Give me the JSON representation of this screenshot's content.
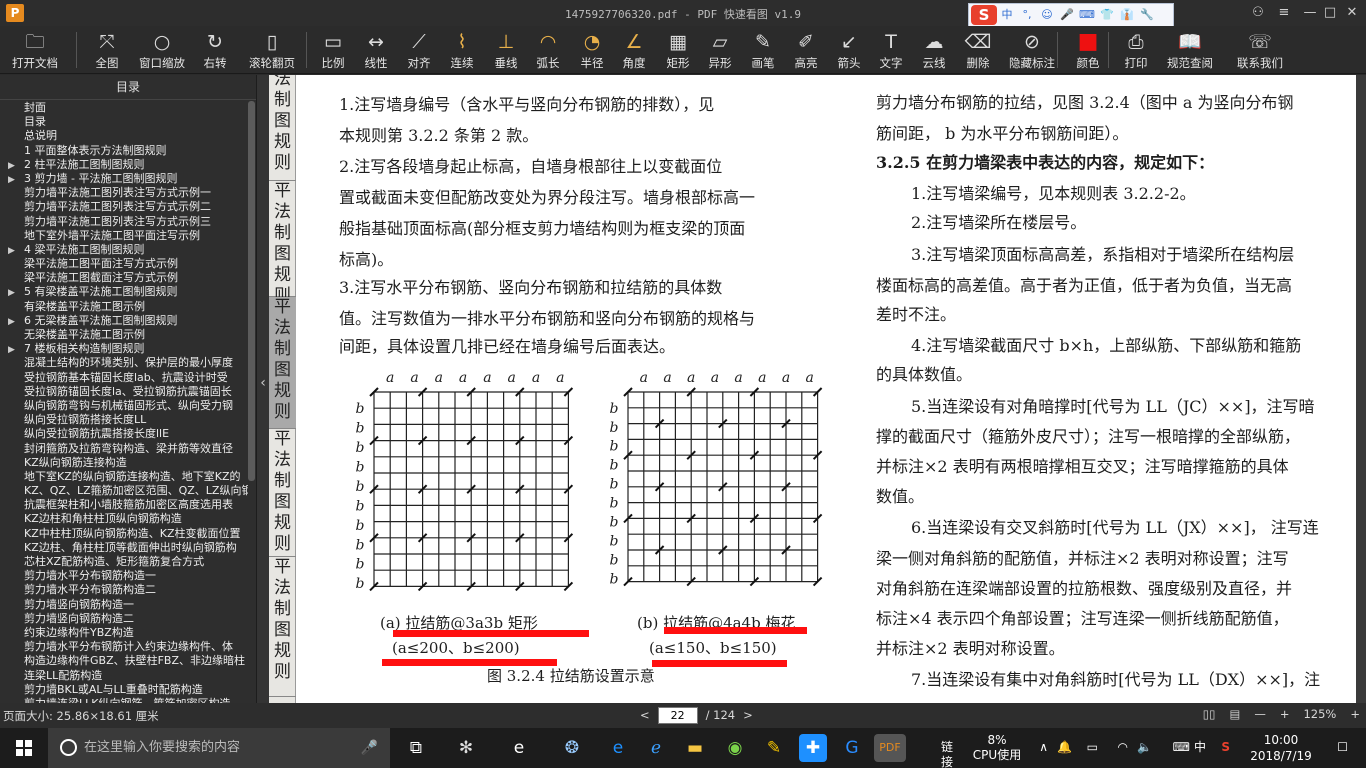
{
  "window": {
    "title": "1475927706320.pdf - PDF 快速看图 v1.9",
    "logo_letter": "P",
    "controls": [
      "≡",
      "—",
      "□",
      "✕"
    ],
    "user_icon": "person-icon"
  },
  "ime": {
    "logo": "S",
    "items": [
      "中",
      "°,",
      "☺",
      "🎤",
      "⌨",
      "👕",
      "👔",
      "🔧"
    ]
  },
  "toolbar": {
    "tools": [
      {
        "label": "打开文档",
        "icon": "folder-icon",
        "glyph": "🗀"
      },
      {
        "label": "全图",
        "icon": "fullview-icon",
        "glyph": "⤧"
      },
      {
        "label": "窗口缩放",
        "icon": "magnifier-icon",
        "glyph": "○"
      },
      {
        "label": "右转",
        "icon": "rotate-right-icon",
        "glyph": "↻"
      },
      {
        "label": "滚轮翻页",
        "icon": "mouse-icon",
        "glyph": "▯"
      },
      {
        "label": "比例",
        "icon": "ruler-icon",
        "glyph": "▭"
      },
      {
        "label": "线性",
        "icon": "linear-measure-icon",
        "glyph": "↔"
      },
      {
        "label": "对齐",
        "icon": "aligned-measure-icon",
        "glyph": "⟋"
      },
      {
        "label": "连续",
        "icon": "continuous-measure-icon",
        "glyph": "⌇"
      },
      {
        "label": "垂线",
        "icon": "perpendicular-icon",
        "glyph": "⊥"
      },
      {
        "label": "弧长",
        "icon": "arc-length-icon",
        "glyph": "◠"
      },
      {
        "label": "半径",
        "icon": "radius-icon",
        "glyph": "◔"
      },
      {
        "label": "角度",
        "icon": "angle-icon",
        "glyph": "∠"
      },
      {
        "label": "矩形",
        "icon": "rectangle-icon",
        "glyph": "▦"
      },
      {
        "label": "异形",
        "icon": "polygon-icon",
        "glyph": "▱"
      },
      {
        "label": "画笔",
        "icon": "pen-icon",
        "glyph": "✎"
      },
      {
        "label": "高亮",
        "icon": "highlighter-icon",
        "glyph": "✐"
      },
      {
        "label": "箭头",
        "icon": "arrow-icon",
        "glyph": "↙"
      },
      {
        "label": "文字",
        "icon": "text-icon",
        "glyph": "T"
      },
      {
        "label": "云线",
        "icon": "cloud-line-icon",
        "glyph": "☁"
      },
      {
        "label": "删除",
        "icon": "eraser-icon",
        "glyph": "⌫"
      },
      {
        "label": "隐藏标注",
        "icon": "hide-annotations-icon",
        "glyph": "⊘"
      },
      {
        "label": "颜色",
        "icon": "color-swatch-icon",
        "glyph": "■"
      },
      {
        "label": "打印",
        "icon": "printer-icon",
        "glyph": "⎙"
      },
      {
        "label": "规范查阅",
        "icon": "book-icon",
        "glyph": "📖"
      },
      {
        "label": "联系我们",
        "icon": "contact-icon",
        "glyph": "☏"
      }
    ]
  },
  "sidebar": {
    "header": "目录",
    "items": [
      {
        "label": "封面",
        "arrow": ""
      },
      {
        "label": "目录",
        "arrow": ""
      },
      {
        "label": "总说明",
        "arrow": ""
      },
      {
        "label": "1 平面整体表示方法制图规则",
        "arrow": ""
      },
      {
        "label": "2 柱平法施工图制图规则",
        "arrow": "▶"
      },
      {
        "label": "3 剪力墙 - 平法施工图制图规则",
        "arrow": "▶"
      },
      {
        "label": "剪力墙平法施工图列表注写方式示例一",
        "arrow": ""
      },
      {
        "label": "剪力墙平法施工图列表注写方式示例二",
        "arrow": ""
      },
      {
        "label": "剪力墙平法施工图列表注写方式示例三",
        "arrow": ""
      },
      {
        "label": "地下室外墙平法施工图平面注写示例",
        "arrow": ""
      },
      {
        "label": "4 梁平法施工图制图规则",
        "arrow": "▶"
      },
      {
        "label": "梁平法施工图平面注写方式示例",
        "arrow": ""
      },
      {
        "label": "梁平法施工图截面注写方式示例",
        "arrow": ""
      },
      {
        "label": "5 有梁楼盖平法施工图制图规则",
        "arrow": "▶"
      },
      {
        "label": "有梁楼盖平法施工图示例",
        "arrow": ""
      },
      {
        "label": "6 无梁楼盖平法施工图制图规则",
        "arrow": "▶"
      },
      {
        "label": "无梁楼盖平法施工图示例",
        "arrow": ""
      },
      {
        "label": "7 楼板相关构造制图规则",
        "arrow": "▶"
      },
      {
        "label": "混凝土结构的环境类别、保护层的最小厚度",
        "arrow": ""
      },
      {
        "label": "受拉钢筋基本锚固长度lab、抗震设计时受",
        "arrow": ""
      },
      {
        "label": "受拉钢筋锚固长度la、受拉钢筋抗震锚固长",
        "arrow": ""
      },
      {
        "label": "纵向钢筋弯钩与机械锚固形式、纵向受力钢",
        "arrow": ""
      },
      {
        "label": "纵向受拉钢筋搭接长度LL",
        "arrow": ""
      },
      {
        "label": "纵向受拉钢筋抗震搭接长度llE",
        "arrow": ""
      },
      {
        "label": "封闭箍筋及拉筋弯钩构造、梁并筋等效直径",
        "arrow": ""
      },
      {
        "label": "KZ纵向钢筋连接构造",
        "arrow": ""
      },
      {
        "label": "地下室KZ的纵向钢筋连接构造、地下室KZ的",
        "arrow": ""
      },
      {
        "label": "KZ、QZ、LZ箍筋加密区范围、QZ、LZ纵向钢",
        "arrow": ""
      },
      {
        "label": "抗震框架柱和小墙肢箍筋加密区高度选用表",
        "arrow": ""
      },
      {
        "label": "KZ边柱和角柱柱顶纵向钢筋构造",
        "arrow": ""
      },
      {
        "label": "KZ中柱柱顶纵向钢筋构造、KZ柱变截面位置",
        "arrow": ""
      },
      {
        "label": "KZ边柱、角柱柱顶等截面伸出时纵向钢筋构",
        "arrow": ""
      },
      {
        "label": "芯柱XZ配筋构造、矩形箍筋复合方式",
        "arrow": ""
      },
      {
        "label": "剪力墙水平分布钢筋构造一",
        "arrow": ""
      },
      {
        "label": "剪力墙水平分布钢筋构造二",
        "arrow": ""
      },
      {
        "label": "剪力墙竖向钢筋构造一",
        "arrow": ""
      },
      {
        "label": "剪力墙竖向钢筋构造二",
        "arrow": ""
      },
      {
        "label": "约束边缘构件YBZ构造",
        "arrow": ""
      },
      {
        "label": "剪力墙水平分布钢筋计入约束边缘构件、体",
        "arrow": ""
      },
      {
        "label": "构造边缘构件GBZ、扶壁柱FBZ、非边缘暗柱",
        "arrow": ""
      },
      {
        "label": "连梁LL配筋构造",
        "arrow": ""
      },
      {
        "label": "剪力墙BKL或AL与LL重叠时配筋构造",
        "arrow": ""
      },
      {
        "label": "剪力墙连梁LLK纵向钢筋、箍筋加密区构造",
        "arrow": ""
      }
    ]
  },
  "document": {
    "tabs": [
      "法制图规则",
      "平法制图规则",
      "平法制图规则",
      "平法制图规则",
      "平法制图规则"
    ],
    "left_paras": [
      "1.注写墙身编号（含水平与竖向分布钢筋的排数），见",
      "本规则第 3.2.2 条第 2 款。",
      "2.注写各段墙身起止标高，自墙身根部往上以变截面位",
      "置或截面未变但配筋改变处为界分段注写。墙身根部标高一",
      "般指基础顶面标高(部分框支剪力墙结构则为框支梁的顶面",
      "标高)。",
      "3.注写水平分布钢筋、竖向分布钢筋和拉结筋的具体数",
      "值。注写数值为一排水平分布钢筋和竖向分布钢筋的规格与",
      "间距，具体设置几排已经在墙身编号后面表达。"
    ],
    "right_paras": [
      "剪力墙分布钢筋的拉结，见图 3.2.4（图中 a 为竖向分布钢",
      "筋间距， b 为水平分布钢筋间距）。",
      "3.2.5 在剪力墙梁表中表达的内容，规定如下：",
      "1.注写墙梁编号，见本规则表 3.2.2-2。",
      "2.注写墙梁所在楼层号。",
      "3.注写墙梁顶面标高高差，系指相对于墙梁所在结构层",
      "楼面标高的高差值。高于者为正值，低于者为负值，当无高",
      "差时不注。",
      "4.注写墙梁截面尺寸 b×h，上部纵筋、下部纵筋和箍筋",
      "的具体数值。",
      "5.当连梁设有对角暗撑时[代号为 LL（JC）××]，注写暗",
      "撑的截面尺寸（箍筋外皮尺寸）；注写一根暗撑的全部纵筋，",
      "并标注×2 表明有两根暗撑相互交叉；注写暗撑箍筋的具体",
      "数值。",
      "6.当连梁设有交叉斜筋时[代号为 LL（JX）××]， 注写连",
      "梁一侧对角斜筋的配筋值，并标注×2 表明对称设置；注写",
      "对角斜筋在连梁端部设置的拉筋根数、强度级别及直径，并",
      "标注×4 表示四个角部设置；注写连梁一侧折线筋配筋值，",
      "并标注×2 表明对称设置。",
      "7.当连梁设有集中对角斜筋时[代号为 LL（DX）××]，注"
    ],
    "figure": {
      "axis_a": "a",
      "axis_b": "b",
      "cap_a1": "(a) 拉结筋@3a3b 矩形",
      "cap_a2": "(a≤200、b≤200)",
      "cap_b1": "(b) 拉结筋@4a4b 梅花",
      "cap_b2": "(a≤150、b≤150)",
      "title": "图 3.2.4 拉结筋设置示意"
    }
  },
  "statusbar": {
    "page_size": "页面大小: 25.86×18.61 厘米",
    "prev": "<",
    "current_page": "22",
    "total": "/ 124",
    "next": ">",
    "zoom": "125%",
    "zoom_minus": "—",
    "zoom_plus": "+"
  },
  "taskbar": {
    "search_placeholder": "在这里输入你要搜索的内容",
    "link_label": "链接",
    "cpu_percent": "8%",
    "cpu_label": "CPU使用",
    "ime_lang": "中",
    "time": "10:00",
    "date": "2018/7/19"
  },
  "colors": {
    "toolbar_bg": "#2b2b2b",
    "red_mark": "#ff1010",
    "accent_gold": "#e8b04a"
  }
}
